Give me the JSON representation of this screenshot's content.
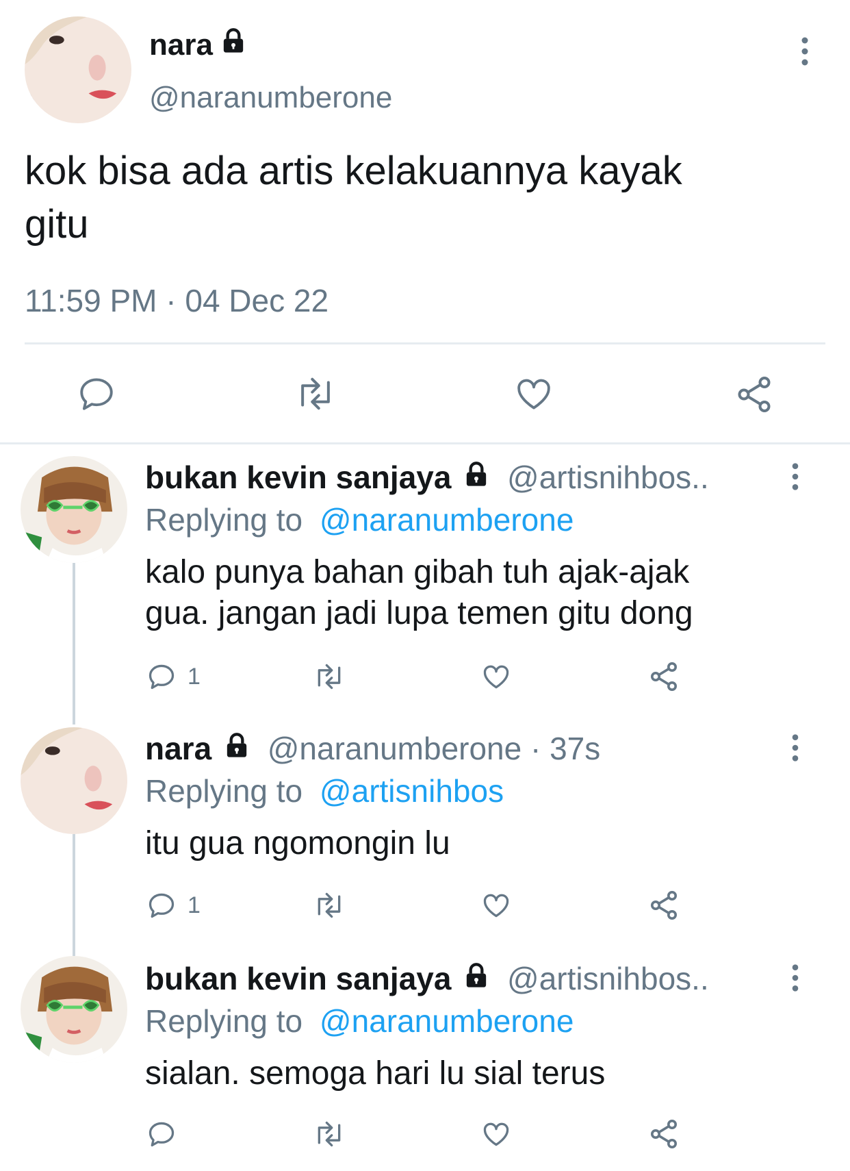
{
  "main_tweet": {
    "author_name": "nara",
    "author_handle": "@naranumberone",
    "text_line1": "kok bisa ada artis kelakuannya kayak",
    "text_line2": "gitu",
    "timestamp": "11:59 PM · 04 Dec 22"
  },
  "replies": [
    {
      "author_name": "bukan kevin sanjaya",
      "author_handle": "@artisnihbos..",
      "replying_prefix": "Replying to",
      "replying_to": "@naranumberone",
      "text_line1": "kalo punya bahan gibah tuh ajak-ajak",
      "text_line2": "gua. jangan jadi lupa temen gitu dong",
      "reply_count": "1"
    },
    {
      "author_name": "nara",
      "author_handle": "@naranumberone · 37s",
      "replying_prefix": "Replying to",
      "replying_to": "@artisnihbos",
      "text_line1": "itu gua ngomongin lu",
      "reply_count": "1"
    },
    {
      "author_name": "bukan kevin sanjaya",
      "author_handle": "@artisnihbos..",
      "replying_prefix": "Replying to",
      "replying_to": "@naranumberone",
      "text_line1": "sialan. semoga hari lu sial terus"
    }
  ],
  "icons": [
    "lock-icon",
    "more-vertical-icon",
    "reply-icon",
    "retweet-icon",
    "like-icon",
    "share-icon"
  ],
  "colors": {
    "link": "#1da1f2",
    "secondary": "#657786",
    "divider": "#e6ecf0",
    "thread_line": "#ccd6dd"
  }
}
